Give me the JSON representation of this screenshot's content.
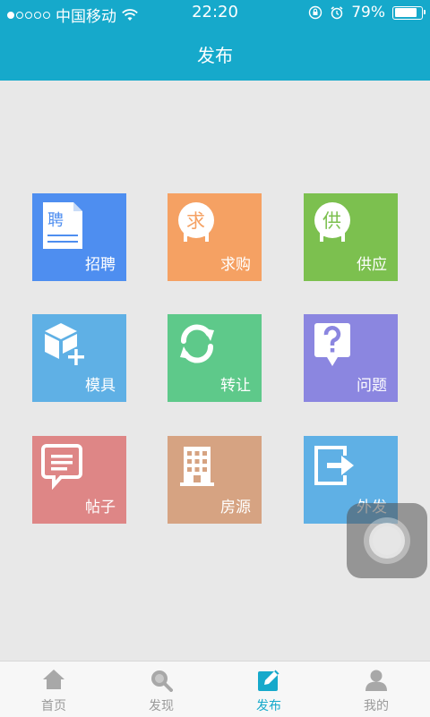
{
  "status_bar": {
    "carrier": "中国移动",
    "time": "22:20",
    "battery": "79%"
  },
  "header": {
    "title": "发布"
  },
  "tiles": [
    {
      "label": "招聘",
      "icon": "resume-doc-icon",
      "glyph": "聘",
      "color": "#4e8ef0"
    },
    {
      "label": "求购",
      "icon": "buy-bubble-icon",
      "glyph": "求",
      "color": "#f5a163"
    },
    {
      "label": "供应",
      "icon": "supply-bubble-icon",
      "glyph": "供",
      "color": "#7cc04f"
    },
    {
      "label": "模具",
      "icon": "cube-plus-icon",
      "color": "#5fb0e5"
    },
    {
      "label": "转让",
      "icon": "refresh-icon",
      "color": "#5ec98a"
    },
    {
      "label": "问题",
      "icon": "question-bubble-icon",
      "color": "#8b86e0"
    },
    {
      "label": "帖子",
      "icon": "chat-list-icon",
      "color": "#de8686"
    },
    {
      "label": "房源",
      "icon": "building-icon",
      "color": "#d6a382"
    },
    {
      "label": "外发",
      "icon": "export-icon",
      "color": "#5fb0e5"
    }
  ],
  "tabbar": {
    "tabs": [
      {
        "label": "首页",
        "icon": "home-icon"
      },
      {
        "label": "发现",
        "icon": "search-icon"
      },
      {
        "label": "发布",
        "icon": "edit-icon",
        "active": true
      },
      {
        "label": "我的",
        "icon": "person-icon"
      }
    ]
  },
  "colors": {
    "header": "#16a9cb",
    "background": "#e8e8e8",
    "tab_active": "#16a9cb",
    "tab_inactive": "#9a9a9a"
  }
}
